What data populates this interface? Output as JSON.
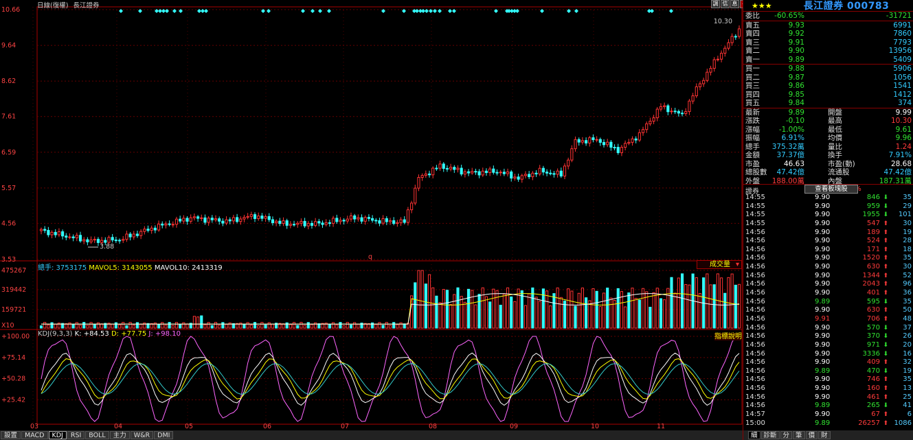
{
  "chart": {
    "title_tag": "日線(復權)",
    "stock_name": "長江證券",
    "high_label": "10.30",
    "low_label": "3.88",
    "price_axis": [
      "10.66",
      "9.64",
      "8.62",
      "7.61",
      "6.59",
      "5.57",
      "4.56",
      "3.53"
    ],
    "month_labels": [
      "03",
      "04",
      "05",
      "06",
      "07",
      "08",
      "09",
      "10",
      "11"
    ],
    "marker_q": "q",
    "volume_label_prefix": "總手:",
    "volume_total": "3753175",
    "mavol5_label": "MAVOL5:",
    "mavol5": "3143055",
    "mavol10_label": "MAVOL10:",
    "mavol10": "2413319",
    "volume_axis": [
      "475267",
      "319442",
      "159721",
      "X10"
    ],
    "volume_dropdown": "成交量",
    "kdj_label": "KDJ(9,3,3)",
    "kdj_k": "K: +84.53",
    "kdj_d": "D: +77.75",
    "kdj_j": "J: +98.10",
    "kdj_help": "指標說明",
    "kdj_axis": [
      "+100.00",
      "+75.14",
      "+50.28",
      "+25.42"
    ],
    "top_icons": [
      "調",
      "信",
      "息",
      "⇥"
    ],
    "colors": {
      "up": "#ff3333",
      "down": "#33ffff",
      "k": "#ffffff",
      "d": "#ffff00",
      "j": "#ff66ff",
      "grid": "#800000"
    }
  },
  "chart_data": {
    "type": "candlestick",
    "months": [
      "03",
      "04",
      "05",
      "06",
      "07",
      "08",
      "09",
      "10",
      "11"
    ],
    "price_ylim": [
      3.53,
      10.66
    ],
    "last_close": 9.89,
    "high": 10.3,
    "low": 3.88,
    "indicators": {
      "K": 84.53,
      "D": 77.75,
      "J": 98.1,
      "MAVOL5": 3143055,
      "MAVOL10": 2413319,
      "volume": 3753175
    }
  },
  "quote": {
    "title": "長江證券 000783",
    "stars": "★★★",
    "ratio_label": "委比",
    "ratio_pct": "-60.65%",
    "ratio_val": "-31721",
    "asks": [
      {
        "label": "賣五",
        "price": "9.93",
        "vol": "6991"
      },
      {
        "label": "賣四",
        "price": "9.92",
        "vol": "7860"
      },
      {
        "label": "賣三",
        "price": "9.91",
        "vol": "7793"
      },
      {
        "label": "賣二",
        "price": "9.90",
        "vol": "13956"
      },
      {
        "label": "賣一",
        "price": "9.89",
        "vol": "5409"
      }
    ],
    "bids": [
      {
        "label": "買一",
        "price": "9.88",
        "vol": "5906"
      },
      {
        "label": "買二",
        "price": "9.87",
        "vol": "1056"
      },
      {
        "label": "買三",
        "price": "9.86",
        "vol": "1541"
      },
      {
        "label": "買四",
        "price": "9.85",
        "vol": "1412"
      },
      {
        "label": "買五",
        "price": "9.84",
        "vol": "374"
      }
    ],
    "stats": [
      {
        "l1": "最新",
        "v1": "9.89",
        "c1": "green",
        "l2": "開盤",
        "v2": "9.99",
        "c2": "white"
      },
      {
        "l1": "漲跌",
        "v1": "-0.10",
        "c1": "green",
        "l2": "最高",
        "v2": "10.30",
        "c2": "red"
      },
      {
        "l1": "漲幅",
        "v1": "-1.00%",
        "c1": "green",
        "l2": "最低",
        "v2": "9.61",
        "c2": "green"
      },
      {
        "l1": "振幅",
        "v1": "6.91%",
        "c1": "cyan",
        "l2": "均價",
        "v2": "9.96",
        "c2": "green"
      },
      {
        "l1": "總手",
        "v1": "375.32萬",
        "c1": "cyan",
        "l2": "量比",
        "v2": "1.24",
        "c2": "red"
      },
      {
        "l1": "金額",
        "v1": "37.37億",
        "c1": "cyan",
        "l2": "換手",
        "v2": "7.91%",
        "c2": "cyan"
      },
      {
        "l1": "市盈",
        "v1": "46.63",
        "c1": "white",
        "l2": "市盈(動)",
        "v2": "28.68",
        "c2": "white"
      },
      {
        "l1": "總股數",
        "v1": "47.42億",
        "c1": "cyan",
        "l2": "流通股",
        "v2": "47.42億",
        "c2": "cyan"
      },
      {
        "l1": "外盤",
        "v1": "188.00萬",
        "c1": "red",
        "l2": "內盤",
        "v2": "187.31萬",
        "c2": "green"
      }
    ],
    "ticks_header": "證券",
    "ticks_header_pct": "0.23%",
    "zoom_button": "查看板塊股",
    "ticks": [
      {
        "t": "14:55",
        "p": "9.90",
        "v": "846",
        "d": "down",
        "n": "35"
      },
      {
        "t": "14:55",
        "p": "9.90",
        "v": "959",
        "d": "down",
        "n": "29"
      },
      {
        "t": "14:55",
        "p": "9.90",
        "v": "1955",
        "d": "down",
        "n": "101"
      },
      {
        "t": "14:55",
        "p": "9.90",
        "v": "547",
        "d": "up",
        "n": "30"
      },
      {
        "t": "14:56",
        "p": "9.90",
        "v": "189",
        "d": "up",
        "n": "19"
      },
      {
        "t": "14:56",
        "p": "9.90",
        "v": "524",
        "d": "up",
        "n": "28"
      },
      {
        "t": "14:56",
        "p": "9.90",
        "v": "171",
        "d": "up",
        "n": "18"
      },
      {
        "t": "14:56",
        "p": "9.90",
        "v": "1520",
        "d": "up",
        "n": "35"
      },
      {
        "t": "14:56",
        "p": "9.90",
        "v": "630",
        "d": "up",
        "n": "30"
      },
      {
        "t": "14:56",
        "p": "9.90",
        "v": "1344",
        "d": "up",
        "n": "52"
      },
      {
        "t": "14:56",
        "p": "9.90",
        "v": "2043",
        "d": "up",
        "n": "96"
      },
      {
        "t": "14:56",
        "p": "9.90",
        "v": "401",
        "d": "up",
        "n": "36"
      },
      {
        "t": "14:56",
        "p": "9.89",
        "v": "595",
        "d": "down",
        "n": "35"
      },
      {
        "t": "14:56",
        "p": "9.90",
        "v": "630",
        "d": "up",
        "n": "50"
      },
      {
        "t": "14:56",
        "p": "9.91",
        "v": "706",
        "d": "up",
        "n": "48"
      },
      {
        "t": "14:56",
        "p": "9.90",
        "v": "570",
        "d": "down",
        "n": "37"
      },
      {
        "t": "14:56",
        "p": "9.90",
        "v": "370",
        "d": "down",
        "n": "26"
      },
      {
        "t": "14:56",
        "p": "9.90",
        "v": "971",
        "d": "down",
        "n": "20"
      },
      {
        "t": "14:56",
        "p": "9.90",
        "v": "3336",
        "d": "down",
        "n": "16"
      },
      {
        "t": "14:56",
        "p": "9.90",
        "v": "409",
        "d": "up",
        "n": "32"
      },
      {
        "t": "14:56",
        "p": "9.89",
        "v": "470",
        "d": "down",
        "n": "19"
      },
      {
        "t": "14:56",
        "p": "9.90",
        "v": "746",
        "d": "up",
        "n": "35"
      },
      {
        "t": "14:56",
        "p": "9.90",
        "v": "160",
        "d": "up",
        "n": "13"
      },
      {
        "t": "14:56",
        "p": "9.90",
        "v": "461",
        "d": "up",
        "n": "25"
      },
      {
        "t": "14:56",
        "p": "9.89",
        "v": "265",
        "d": "down",
        "n": "41"
      },
      {
        "t": "14:57",
        "p": "9.90",
        "v": "67",
        "d": "up",
        "n": "6"
      },
      {
        "t": "15:00",
        "p": "9.89",
        "v": "26257",
        "d": "up",
        "n": "1086"
      }
    ],
    "tabs": [
      "細",
      "診斷",
      "分",
      "筆",
      "價",
      "財"
    ]
  },
  "bottom_tabs": [
    "設置",
    "MACD",
    "KDJ",
    "RSI",
    "BOLL",
    "主力",
    "W&R",
    "DMI"
  ]
}
